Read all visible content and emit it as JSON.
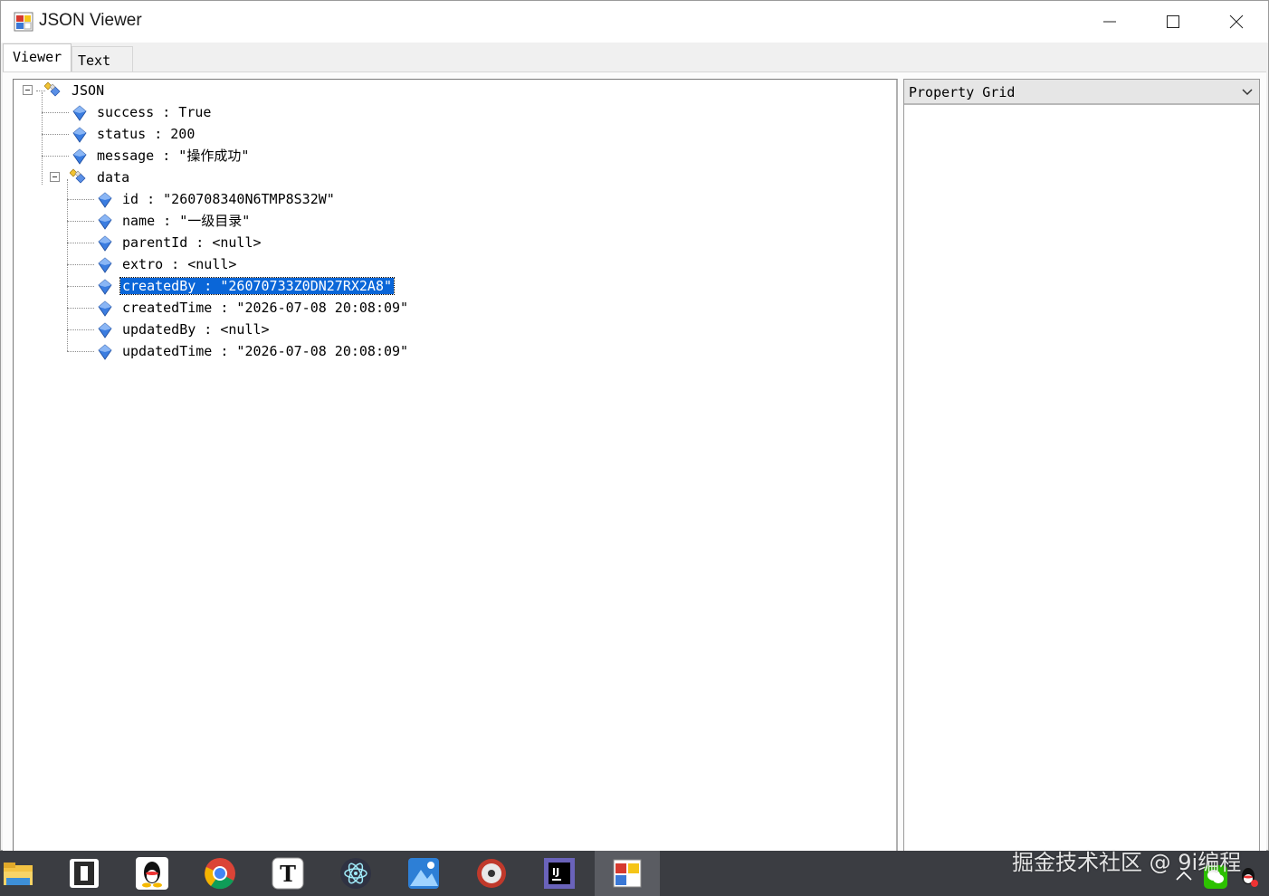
{
  "window": {
    "title": "JSON Viewer"
  },
  "tabs": [
    {
      "label": "Viewer"
    },
    {
      "label": "Text"
    }
  ],
  "tree": {
    "root": "JSON",
    "nodes": [
      {
        "text": "success : True"
      },
      {
        "text": "status : 200"
      },
      {
        "text": "message : \"操作成功\""
      },
      {
        "text": "data"
      },
      {
        "text": "id : \"260708340N6TMP8S32W\""
      },
      {
        "text": "name : \"一级目录\""
      },
      {
        "text": "parentId : <null>"
      },
      {
        "text": "extro : <null>"
      },
      {
        "text": "createdBy : \"26070733Z0DN27RX2A8\""
      },
      {
        "text": "createdTime : \"2026-07-08 20:08:09\""
      },
      {
        "text": "updatedBy : <null>"
      },
      {
        "text": "updatedTime : \"2026-07-08 20:08:09\""
      }
    ],
    "selected": "createdBy"
  },
  "property_grid": {
    "title": "Property Grid"
  },
  "watermark": "掘金技术社区 @ 9i编程",
  "colors": {
    "selection": "#0a66d8",
    "taskbar": "#3b3d42"
  }
}
